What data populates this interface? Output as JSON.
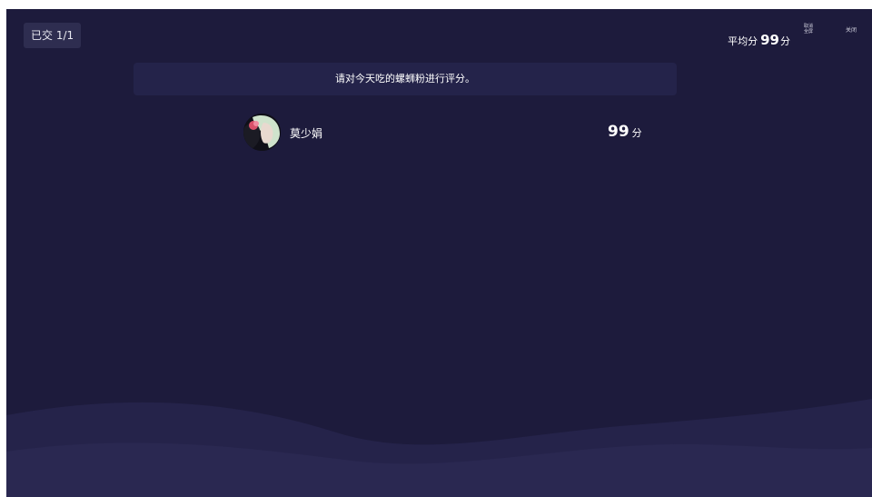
{
  "header": {
    "submitted_label": "已交 1/1",
    "average_prefix": "平均分",
    "average_value": "99",
    "average_unit": "分",
    "exit_fullscreen_label": "取消全屏",
    "close_label": "关闭"
  },
  "question": {
    "text": "请对今天吃的螺蛳粉进行评分。"
  },
  "results": [
    {
      "name": "莫少娟",
      "score": "99",
      "unit": "分"
    }
  ],
  "colors": {
    "background": "#1d1b3c",
    "question_bar": "#24234a",
    "badge": "#2e2d50"
  }
}
